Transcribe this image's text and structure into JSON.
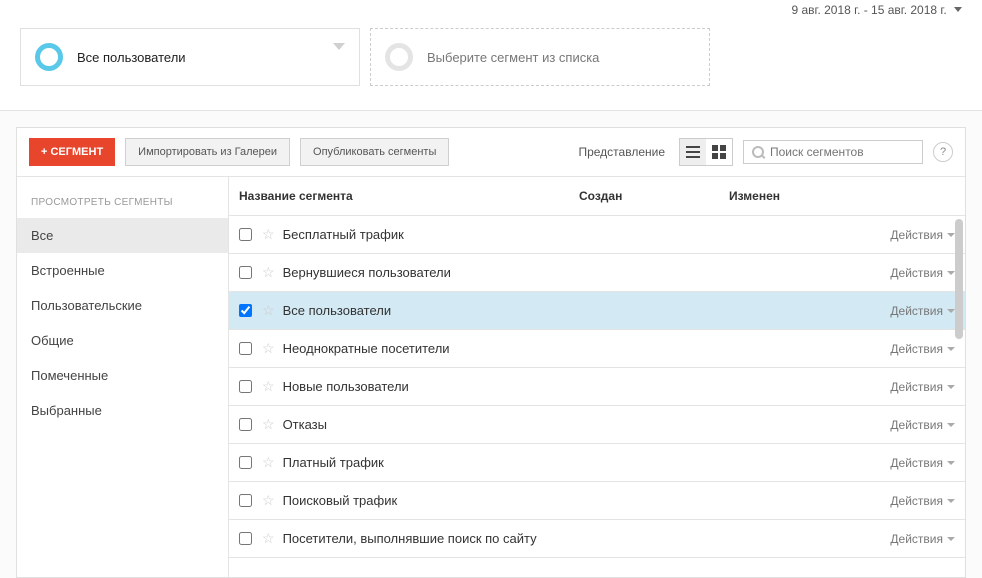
{
  "dateRange": "9 авг. 2018 г. - 15 авг. 2018 г.",
  "segBox": {
    "allUsers": "Все пользователи",
    "choose": "Выберите сегмент из списка"
  },
  "toolbar": {
    "addSegment": "+ СЕГМЕНТ",
    "importGallery": "Импортировать из Галереи",
    "publish": "Опубликовать сегменты",
    "viewLabel": "Представление",
    "searchPlaceholder": "Поиск сегментов",
    "help": "?"
  },
  "sidebar": {
    "header": "ПРОСМОТРЕТЬ СЕГМЕНТЫ",
    "items": [
      {
        "label": "Все",
        "active": true
      },
      {
        "label": "Встроенные",
        "active": false
      },
      {
        "label": "Пользовательские",
        "active": false
      },
      {
        "label": "Общие",
        "active": false
      },
      {
        "label": "Помеченные",
        "active": false
      },
      {
        "label": "Выбранные",
        "active": false
      }
    ]
  },
  "table": {
    "headers": {
      "name": "Название сегмента",
      "created": "Создан",
      "modified": "Изменен"
    },
    "actionsLabel": "Действия",
    "rows": [
      {
        "name": "Бесплатный трафик",
        "selected": false
      },
      {
        "name": "Вернувшиеся пользователи",
        "selected": false
      },
      {
        "name": "Все пользователи",
        "selected": true
      },
      {
        "name": "Неоднократные посетители",
        "selected": false
      },
      {
        "name": "Новые пользователи",
        "selected": false
      },
      {
        "name": "Отказы",
        "selected": false
      },
      {
        "name": "Платный трафик",
        "selected": false
      },
      {
        "name": "Поисковый трафик",
        "selected": false
      },
      {
        "name": "Посетители, выполнявшие поиск по сайту",
        "selected": false
      }
    ]
  }
}
